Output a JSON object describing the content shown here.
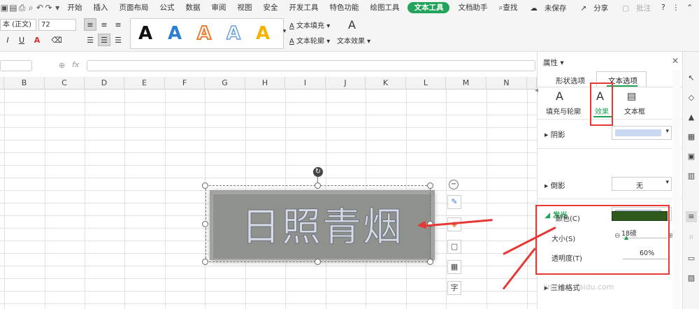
{
  "menubar": {
    "items": [
      "开始",
      "插入",
      "页面布局",
      "公式",
      "数据",
      "审阅",
      "视图",
      "安全",
      "开发工具",
      "特色功能",
      "绘图工具",
      "文本工具",
      "文档助手"
    ],
    "active": "文本工具",
    "search": "查找",
    "unsaved": "未保存",
    "share": "分享",
    "comment": "批注",
    "help": "?"
  },
  "ribbon": {
    "font_name": "本 (正文)",
    "font_size": "72",
    "text_fill": "文本填充",
    "text_outline": "文本轮廓",
    "text_effect": "文本效果",
    "style_glyph": "A",
    "style_colors": [
      "#111111",
      "#2d7fd3",
      "#ed7d31",
      "#6aa0e0",
      "#f4b400"
    ]
  },
  "formulabar": {
    "fx": "fx"
  },
  "grid": {
    "columns": [
      "B",
      "C",
      "D",
      "E",
      "F",
      "G",
      "H",
      "I",
      "J",
      "K",
      "L",
      "M",
      "N"
    ]
  },
  "canvas": {
    "wordart_text": "日照青烟",
    "float_char": "字"
  },
  "panel": {
    "title": "属性",
    "tabs": [
      "形状选项",
      "文本选项"
    ],
    "subtabs": [
      "填充与轮廓",
      "效果",
      "文本框"
    ],
    "shadow": "阴影",
    "reflection": "倒影",
    "reflection_value": "无",
    "glow": "发光",
    "color_label": "颜色(C)",
    "glow_color": "#2f5a1e",
    "size_label": "大小(S)",
    "size_value": "18磅",
    "transparency_label": "透明度(T)",
    "transparency_value": "60%",
    "three_d": "三维格式",
    "watermark": "jingyan.baidu.com"
  }
}
